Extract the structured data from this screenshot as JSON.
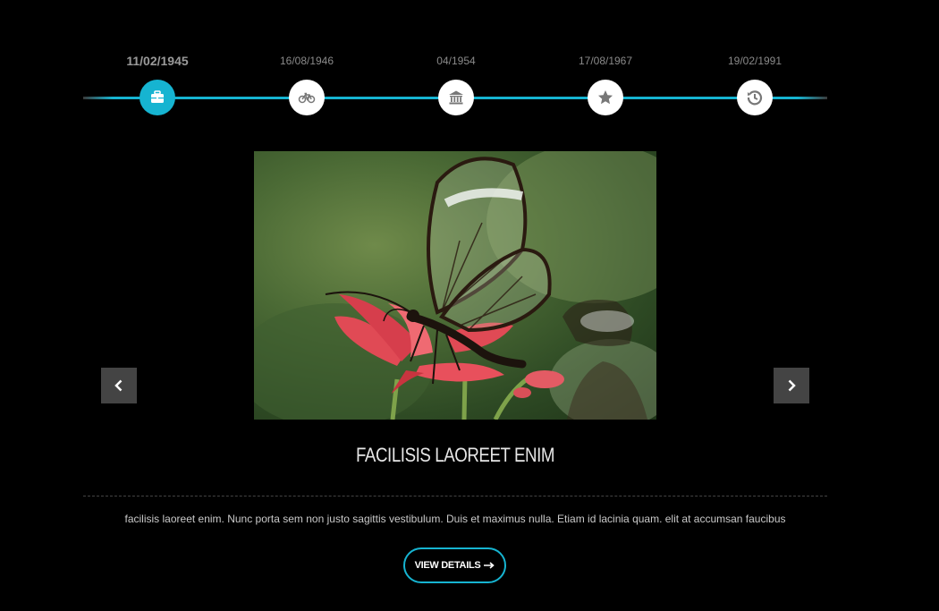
{
  "timeline": {
    "items": [
      {
        "date": "11/02/1945",
        "icon": "briefcase-icon",
        "active": true
      },
      {
        "date": "16/08/1946",
        "icon": "bicycle-icon",
        "active": false
      },
      {
        "date": "04/1954",
        "icon": "bank-icon",
        "active": false
      },
      {
        "date": "17/08/1967",
        "icon": "star-icon",
        "active": false
      },
      {
        "date": "19/02/1991",
        "icon": "history-icon",
        "active": false
      }
    ],
    "accent_color": "#16b4d1"
  },
  "slide": {
    "title": "FACILISIS LAOREET ENIM",
    "description": "facilisis laoreet enim. Nunc porta sem non justo sagittis vestibulum. Duis et maximus nulla. Etiam id lacinia quam. elit at accumsan faucibus",
    "button_label": "VIEW DETAILS"
  },
  "navigation": {
    "prev_icon": "chevron-left-icon",
    "next_icon": "chevron-right-icon"
  }
}
